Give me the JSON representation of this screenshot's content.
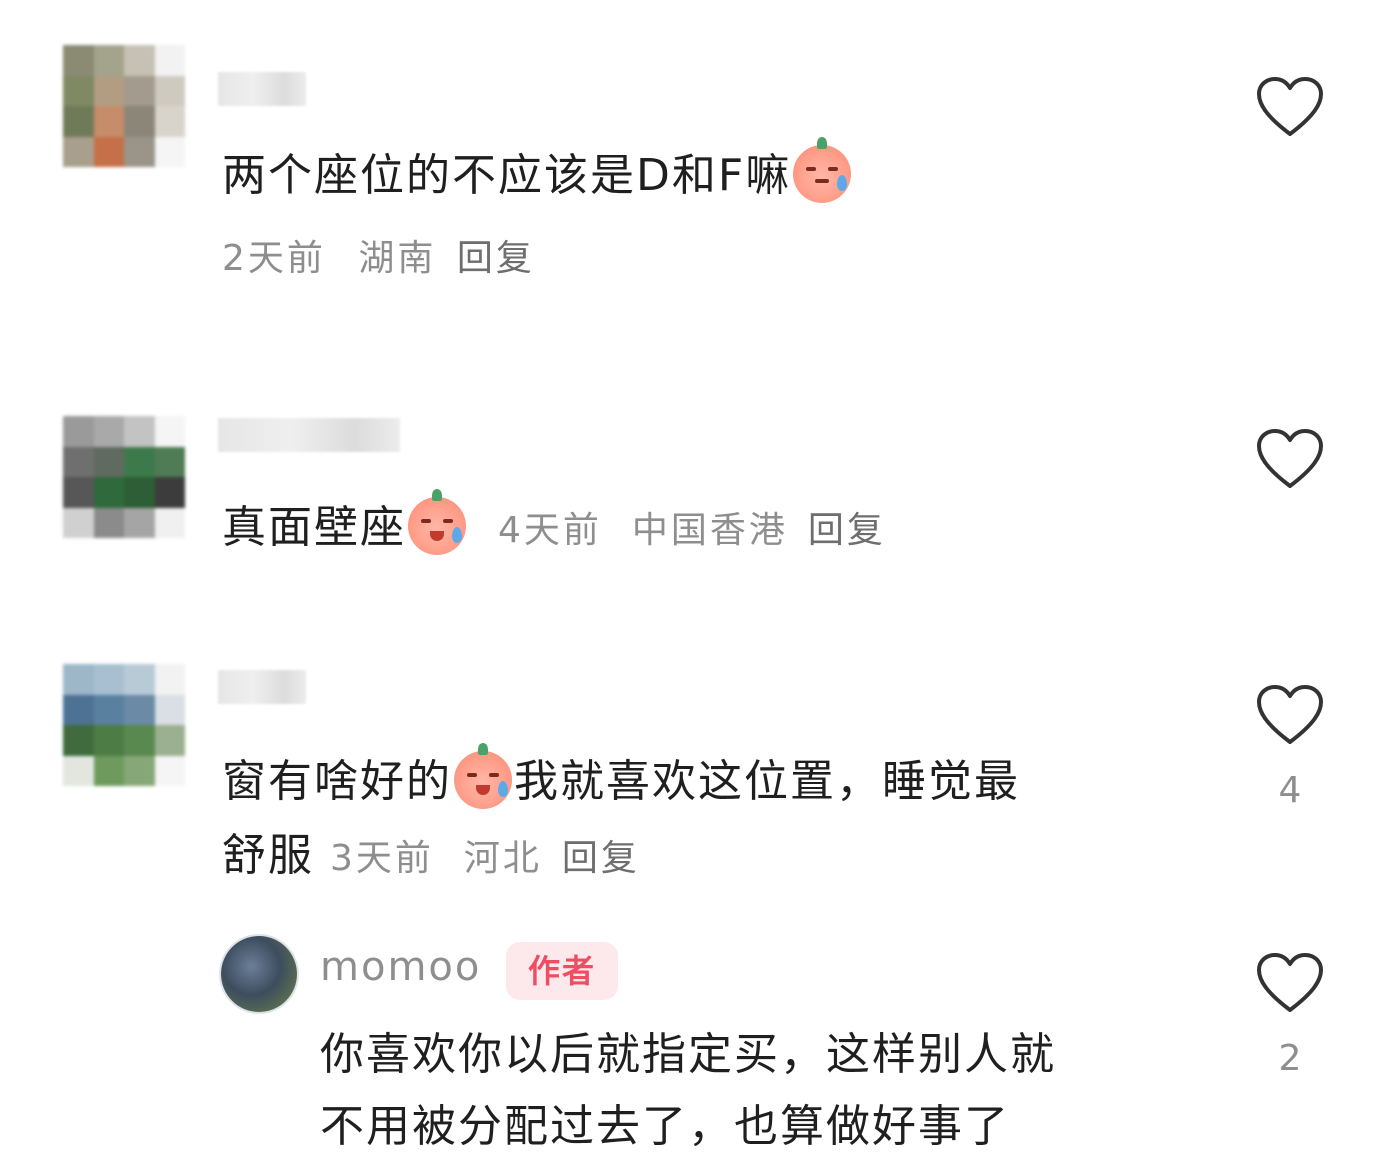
{
  "comments": [
    {
      "text_before_emoji": "两个座位的不应该是D和F嘛",
      "emoji": "sweat-face-emoji",
      "time": "2天前",
      "location": "湖南",
      "reply_label": "回复",
      "like_count": ""
    },
    {
      "text_before_emoji": "真面壁座",
      "emoji": "crying-face-emoji",
      "time": "4天前",
      "location": "中国香港",
      "reply_label": "回复",
      "like_count": ""
    },
    {
      "text_before_emoji": "窗有啥好的",
      "emoji": "crying-face-emoji",
      "text_after_emoji": "我就喜欢这位置，睡觉最",
      "text_line2": "舒服",
      "time": "3天前",
      "location": "河北",
      "reply_label": "回复",
      "like_count": "4"
    }
  ],
  "author_reply": {
    "username": "momoo",
    "badge": "作者",
    "line1": "你喜欢你以后就指定买，这样别人就",
    "line2": "不用被分配过去了，也算做好事了",
    "like_count": "2"
  },
  "icons": {
    "like": "heart-outline-icon"
  },
  "colors": {
    "badge_text": "#ef4d63",
    "badge_bg": "#fde9ec",
    "meta_text": "#8e8e8e"
  }
}
